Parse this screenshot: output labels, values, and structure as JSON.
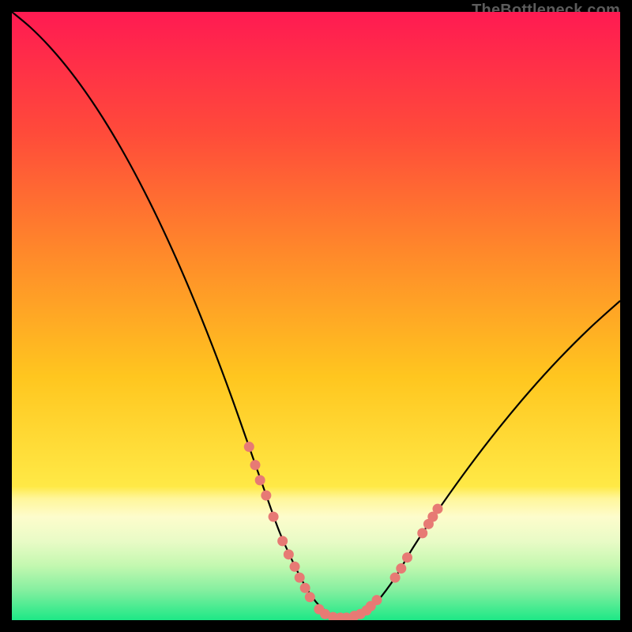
{
  "watermark": "TheBottleneck.com",
  "chart_data": {
    "type": "line",
    "title": "",
    "xlabel": "",
    "ylabel": "",
    "xlim": [
      0,
      100
    ],
    "ylim": [
      0,
      100
    ],
    "grid": false,
    "legend": false,
    "gradient_stops": [
      {
        "offset": 0.0,
        "color": "#ff1a52"
      },
      {
        "offset": 0.2,
        "color": "#ff4b3a"
      },
      {
        "offset": 0.4,
        "color": "#ff8a2a"
      },
      {
        "offset": 0.6,
        "color": "#ffc61f"
      },
      {
        "offset": 0.78,
        "color": "#ffe946"
      },
      {
        "offset": 0.8,
        "color": "#fff69a"
      },
      {
        "offset": 0.83,
        "color": "#fdfccc"
      },
      {
        "offset": 0.87,
        "color": "#e9fbc6"
      },
      {
        "offset": 0.91,
        "color": "#c4f8b0"
      },
      {
        "offset": 0.95,
        "color": "#86efa0"
      },
      {
        "offset": 1.0,
        "color": "#1de886"
      }
    ],
    "series": [
      {
        "name": "bottleneck-curve",
        "color": "#000000",
        "x": [
          0,
          3,
          6,
          9,
          12,
          15,
          18,
          21,
          24,
          27,
          30,
          33,
          36,
          39,
          42,
          44,
          46,
          48,
          50,
          52,
          54,
          56,
          58,
          60,
          63,
          66,
          70,
          75,
          80,
          85,
          90,
          95,
          100
        ],
        "y": [
          100,
          97.5,
          94.5,
          91,
          87,
          82.5,
          77.5,
          72,
          66,
          59.5,
          52.5,
          45,
          37,
          28.5,
          20,
          14.5,
          10,
          6,
          3,
          1.2,
          0.4,
          0.4,
          1.2,
          3,
          7,
          12,
          18,
          25,
          31.5,
          37.5,
          43,
          48,
          52.5
        ]
      }
    ],
    "markers": {
      "name": "highlight-band",
      "color": "#e77a74",
      "radius": 6.5,
      "points": [
        {
          "x": 39.0,
          "y": 28.5
        },
        {
          "x": 40.0,
          "y": 25.5
        },
        {
          "x": 40.8,
          "y": 23.0
        },
        {
          "x": 41.8,
          "y": 20.5
        },
        {
          "x": 43.0,
          "y": 17.0
        },
        {
          "x": 44.5,
          "y": 13.0
        },
        {
          "x": 45.5,
          "y": 10.8
        },
        {
          "x": 46.5,
          "y": 8.8
        },
        {
          "x": 47.3,
          "y": 7.0
        },
        {
          "x": 48.2,
          "y": 5.3
        },
        {
          "x": 49.0,
          "y": 3.8
        },
        {
          "x": 50.5,
          "y": 1.8
        },
        {
          "x": 51.5,
          "y": 1.0
        },
        {
          "x": 52.8,
          "y": 0.5
        },
        {
          "x": 54.0,
          "y": 0.4
        },
        {
          "x": 55.0,
          "y": 0.4
        },
        {
          "x": 56.3,
          "y": 0.7
        },
        {
          "x": 57.3,
          "y": 1.0
        },
        {
          "x": 58.3,
          "y": 1.6
        },
        {
          "x": 59.0,
          "y": 2.3
        },
        {
          "x": 60.0,
          "y": 3.3
        },
        {
          "x": 63.0,
          "y": 7.0
        },
        {
          "x": 64.0,
          "y": 8.5
        },
        {
          "x": 65.0,
          "y": 10.3
        },
        {
          "x": 67.5,
          "y": 14.3
        },
        {
          "x": 68.5,
          "y": 15.8
        },
        {
          "x": 69.2,
          "y": 17.0
        },
        {
          "x": 70.0,
          "y": 18.3
        }
      ]
    }
  }
}
